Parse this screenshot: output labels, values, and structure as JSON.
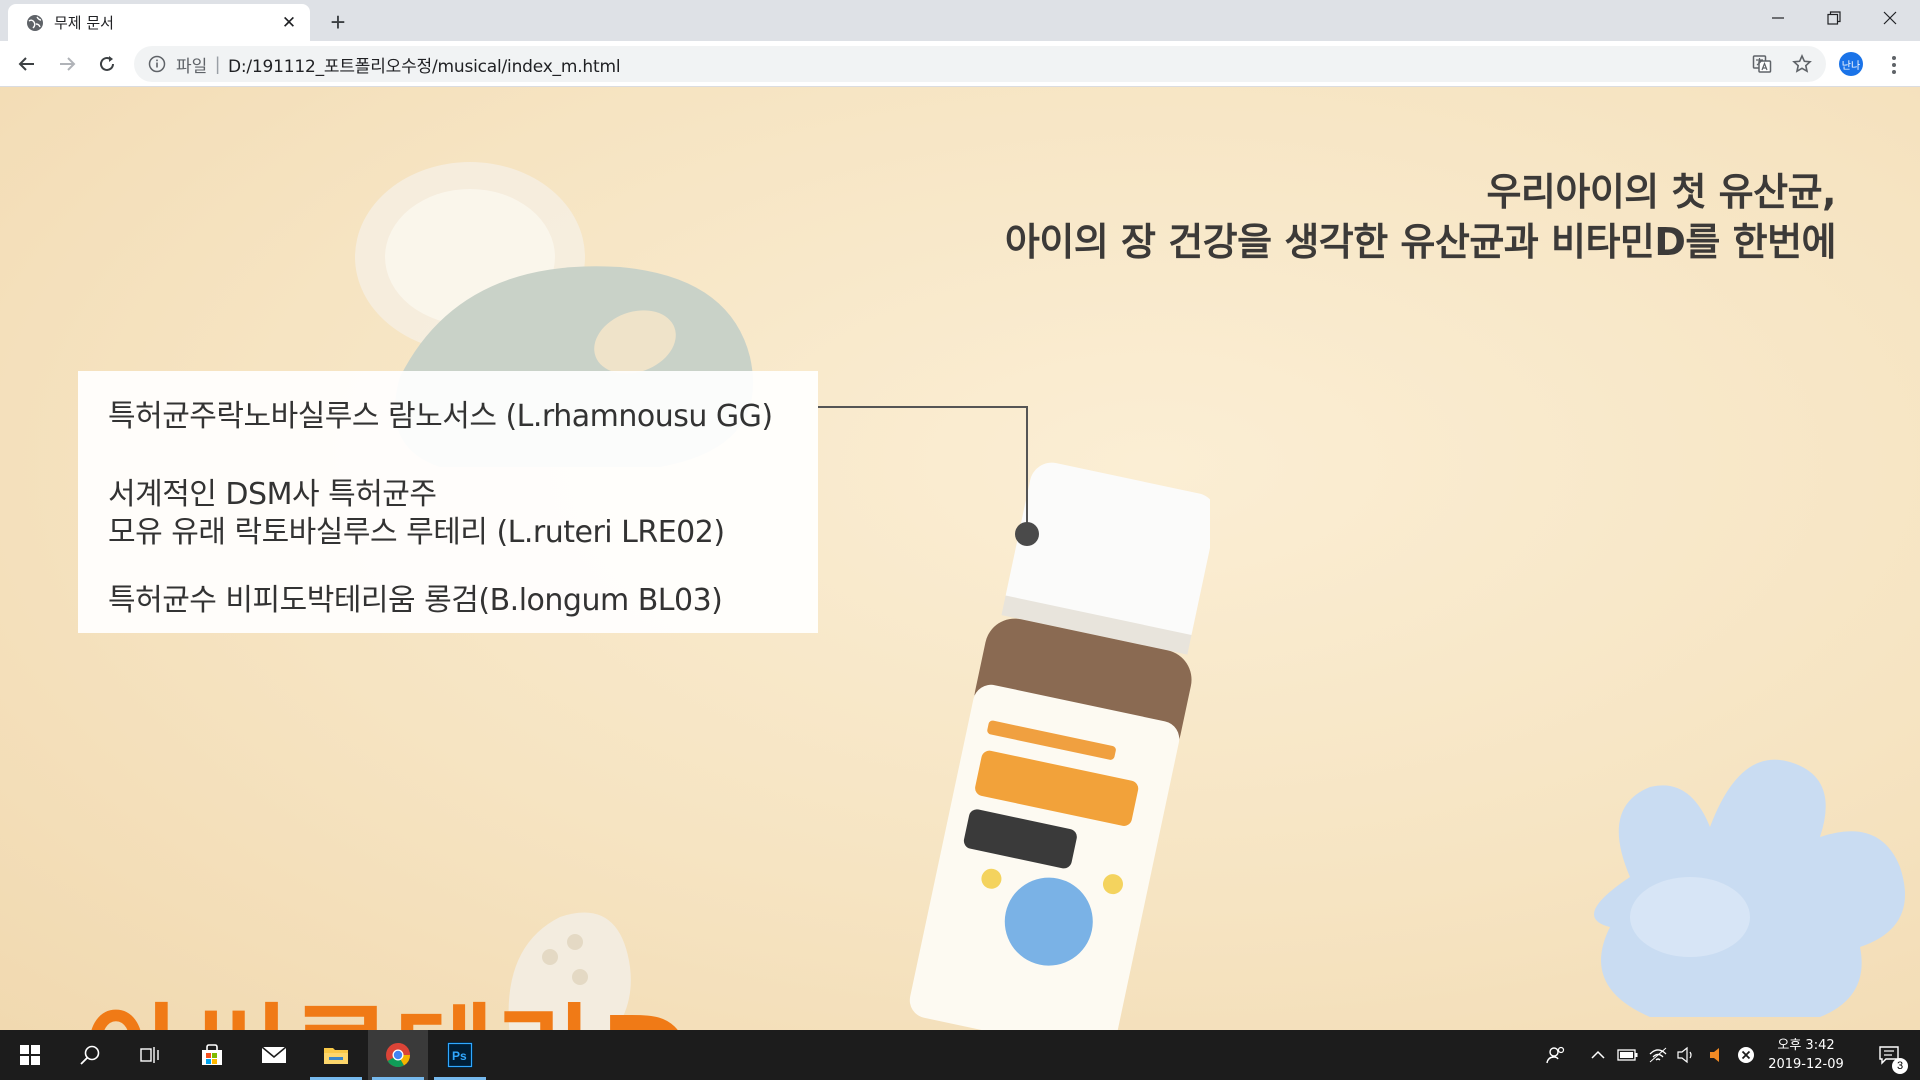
{
  "browser": {
    "tab_title": "무제 문서",
    "address_scheme_label": "파일",
    "address_url": "D:/191112_포트폴리오수정/musical/index_m.html",
    "profile_initials": "난나"
  },
  "page": {
    "headline_line1": "우리아이의 첫 유산균,",
    "headline_line2": "아이의 장 건강을 생각한 유산균과 비타민D를 한번에",
    "info_lines": [
      "특허균주락노바실루스 람노서스 (L.rhamnousu GG)",
      "서계적인 DSM사 특허균주",
      "모유 유래 락토바실루스 루테리 (L.ruteri LRE02)",
      "특허균수 비피도박테리움 롱검(B.longum BL03)"
    ],
    "bottom_title_partial": "아써루테라D",
    "accent_color": "#f07a16"
  },
  "taskbar": {
    "clock_time": "오후 3:42",
    "clock_date": "2019-12-09",
    "notification_count": "3"
  }
}
